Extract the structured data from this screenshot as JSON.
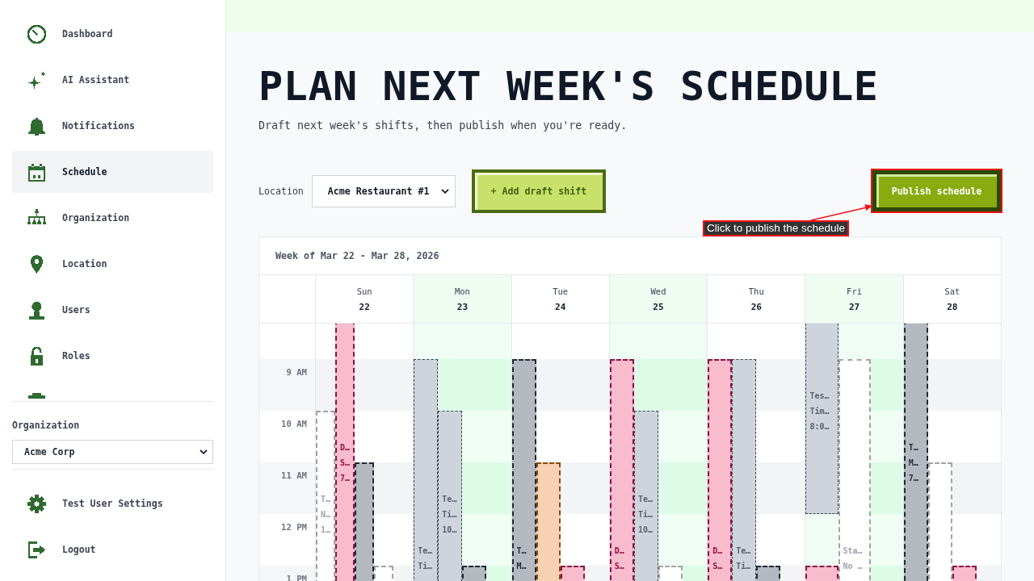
{
  "sidebar": {
    "nav_items": [
      {
        "label": "Dashboard",
        "selected": false
      },
      {
        "label": "AI Assistant",
        "selected": false
      },
      {
        "label": "Notifications",
        "selected": false
      },
      {
        "label": "Schedule",
        "selected": true
      },
      {
        "label": "Organization",
        "selected": false
      },
      {
        "label": "Location",
        "selected": false
      },
      {
        "label": "Users",
        "selected": false
      },
      {
        "label": "Roles",
        "selected": false
      },
      {
        "selected": false
      }
    ],
    "organization": {
      "label": "Organization",
      "value": "Acme Corp"
    },
    "footer_items": [
      {
        "label": "Test User Settings"
      },
      {
        "label": "Logout"
      }
    ]
  },
  "page": {
    "title": "PLAN NEXT WEEK'S SCHEDULE",
    "subtitle": "Draft next week's shifts, then publish when you're ready.",
    "location": {
      "label": "Location",
      "value": "Acme Restaurant #1"
    },
    "add_button": {
      "label": "+ Add draft shift"
    },
    "publish_button": {
      "label": "Publish schedule",
      "highlighted": true
    },
    "callout": {
      "text": "Click to publish the schedule"
    }
  },
  "calendar": {
    "week_label": "Week of Mar 22 - Mar 28, 2026",
    "hours": [
      "9 AM",
      "10 AM",
      "11 AM",
      "12 PM",
      "1 PM"
    ],
    "days": [
      {
        "name": "Sun",
        "date": "22",
        "highlighted": false,
        "kind": "narrow",
        "lanes": [
          [
            {
              "kind": "midday",
              "color": "#ffffff",
              "lines": [
                "T…",
                "N…",
                "1…"
              ]
            }
          ],
          [
            {
              "kind": "opening",
              "color": "#f9bccc",
              "lines": [
                "D…",
                "S…",
                "7…"
              ]
            }
          ],
          [
            {
              "kind": "late",
              "color": "#b4b8bf"
            }
          ],
          [
            {
              "kind": "afternoon",
              "color": "#ffffff"
            }
          ]
        ]
      },
      {
        "name": "Mon",
        "date": "23",
        "highlighted": true,
        "kind": "regular",
        "lanes": [
          [
            {
              "kind": "day",
              "color": "#cfd4dc",
              "lines": [
                "Te…",
                "Ti…"
              ]
            }
          ],
          [
            {
              "kind": "midday",
              "color": "#cfd4dc",
              "lines": [
                "Te…",
                "Ti…",
                "10…"
              ]
            }
          ],
          [
            {
              "kind": "afternoon",
              "color": "#b4b8bf"
            }
          ]
        ]
      },
      {
        "name": "Tue",
        "date": "24",
        "highlighted": false,
        "kind": "regular",
        "lanes": [
          [
            {
              "kind": "day",
              "color": "#b4b8bf",
              "lines": [
                "T…",
                "M…"
              ]
            }
          ],
          [
            {
              "kind": "late",
              "color": "#f6d1b3"
            }
          ],
          [
            {
              "kind": "afternoon",
              "color": "#f9bccc"
            }
          ]
        ]
      },
      {
        "name": "Wed",
        "date": "25",
        "highlighted": true,
        "kind": "regular",
        "lanes": [
          [
            {
              "kind": "day",
              "color": "#f9bccc",
              "lines": [
                "D…",
                "S…"
              ]
            }
          ],
          [
            {
              "kind": "midday",
              "color": "#cfd4dc",
              "lines": [
                "Te…",
                "Ti…",
                "10…"
              ]
            }
          ],
          [
            {
              "kind": "afternoon",
              "color": "#ffffff"
            }
          ]
        ]
      },
      {
        "name": "Thu",
        "date": "26",
        "highlighted": false,
        "kind": "regular",
        "lanes": [
          [
            {
              "kind": "day",
              "color": "#f9bccc",
              "lines": [
                "D…",
                "S…"
              ]
            }
          ],
          [
            {
              "kind": "day",
              "color": "#cfd4dc",
              "lines": [
                "Te…",
                "Ti…"
              ]
            }
          ],
          [
            {
              "kind": "afternoon",
              "color": "#b4b8bf"
            }
          ]
        ]
      },
      {
        "name": "Fri",
        "date": "27",
        "highlighted": true,
        "kind": "wide",
        "lanes": [
          [
            {
              "kind": "morning",
              "color": "#cfd4dc",
              "lines": [
                "Tes…",
                "Tim…",
                "8:0…"
              ]
            },
            {
              "kind": "afternoon",
              "color": "#f9bccc"
            }
          ],
          [
            {
              "kind": "day",
              "color": "#ffffff",
              "lines": [
                "Sta…",
                "No …"
              ]
            }
          ]
        ]
      },
      {
        "name": "Sat",
        "date": "28",
        "highlighted": false,
        "kind": "regular",
        "lanes": [
          [
            {
              "kind": "opening",
              "color": "#b4b8bf",
              "lines": [
                "T…",
                "M…",
                "7…"
              ]
            }
          ],
          [
            {
              "kind": "late",
              "color": "#ffffff"
            }
          ],
          [
            {
              "kind": "afternoon",
              "color": "#f9bccc"
            }
          ]
        ]
      }
    ]
  }
}
